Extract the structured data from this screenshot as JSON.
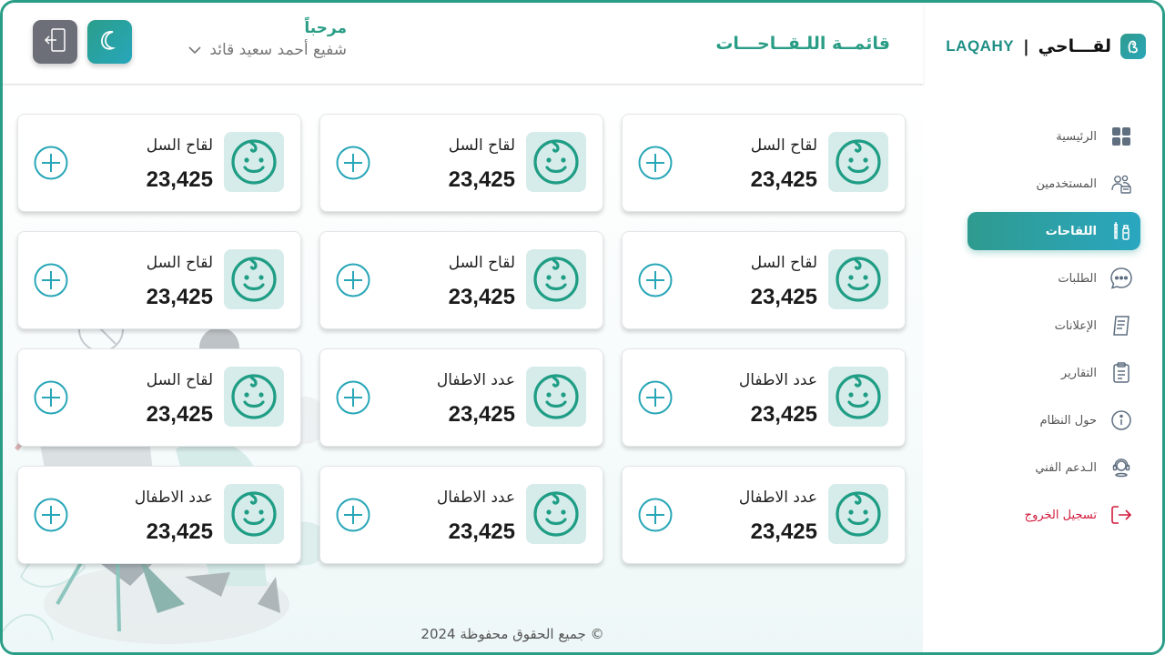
{
  "brand": {
    "name_ar": "لقـــاحي",
    "separator": "|",
    "name_en": "LAQAHY"
  },
  "header": {
    "title": "قائمــة اللـقــاحـــات",
    "welcome": "مرحباً",
    "user_name": "شفيع أحمد سعيد قائد"
  },
  "sidebar": {
    "items": [
      {
        "label": "الرئيسية",
        "icon": "grid-icon",
        "active": false
      },
      {
        "label": "المستخدمين",
        "icon": "users-icon",
        "active": false
      },
      {
        "label": "اللقاحات",
        "icon": "vaccine-icon",
        "active": true
      },
      {
        "label": "الطلبات",
        "icon": "chat-icon",
        "active": false
      },
      {
        "label": "الإعلانات",
        "icon": "document-icon",
        "active": false
      },
      {
        "label": "التقارير",
        "icon": "clipboard-icon",
        "active": false
      },
      {
        "label": "حول النظام",
        "icon": "info-icon",
        "active": false
      },
      {
        "label": "الـدعم الفني",
        "icon": "support-icon",
        "active": false
      },
      {
        "label": "تسجيل الخروج",
        "icon": "logout-icon",
        "active": false
      }
    ]
  },
  "cards": [
    [
      {
        "title": "لقاح السل",
        "value": "23,425"
      },
      {
        "title": "لقاح السل",
        "value": "23,425"
      },
      {
        "title": "لقاح السل",
        "value": "23,425"
      }
    ],
    [
      {
        "title": "لقاح السل",
        "value": "23,425"
      },
      {
        "title": "لقاح السل",
        "value": "23,425"
      },
      {
        "title": "لقاح السل",
        "value": "23,425"
      }
    ],
    [
      {
        "title": "عدد الاطفال",
        "value": "23,425"
      },
      {
        "title": "عدد الاطفال",
        "value": "23,425"
      },
      {
        "title": "لقاح السل",
        "value": "23,425"
      }
    ],
    [
      {
        "title": "عدد الاطفال",
        "value": "23,425"
      },
      {
        "title": "عدد الاطفال",
        "value": "23,425"
      },
      {
        "title": "عدد الاطفال",
        "value": "23,425"
      }
    ]
  ],
  "footer": {
    "copyright": "جميع الحقوق محفوظة 2024 ©"
  },
  "colors": {
    "primary": "#2a9d86",
    "accent": "#27a7bb",
    "danger": "#d11a3c",
    "card_icon_bg": "#d6ecea"
  }
}
